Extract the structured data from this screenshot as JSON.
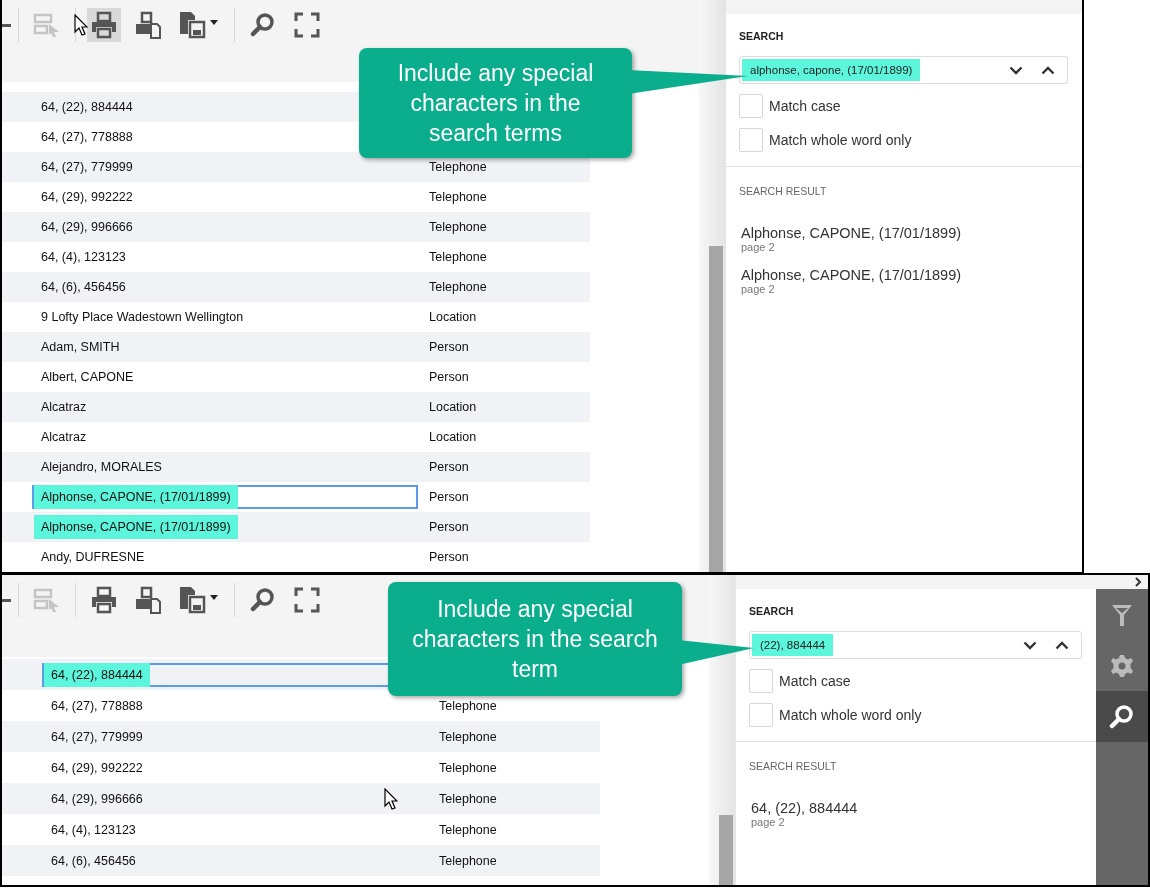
{
  "panels": [
    {
      "toolbar": [
        {
          "kind": "edge",
          "disabled": false,
          "hovered": false
        },
        {
          "kind": "select",
          "disabled": true,
          "hovered": false
        },
        {
          "kind": "print",
          "disabled": false,
          "hovered": true
        },
        {
          "kind": "export",
          "disabled": false,
          "hovered": false
        },
        {
          "kind": "save",
          "disabled": false,
          "hovered": false
        },
        {
          "kind": "search",
          "disabled": false,
          "hovered": false
        },
        {
          "kind": "fullscreen",
          "disabled": false,
          "hovered": false
        }
      ],
      "rows": [
        {
          "name": "64, (22), 884444",
          "highlighted": false,
          "selected": false
        },
        {
          "name": "64, (27), 778888",
          "highlighted": false,
          "selected": false
        },
        {
          "name": "64, (27), 779999",
          "type": "Telephone",
          "highlighted": false,
          "selected": false
        },
        {
          "name": "64, (29), 992222",
          "type": "Telephone",
          "highlighted": false,
          "selected": false
        },
        {
          "name": "64, (29), 996666",
          "type": "Telephone",
          "highlighted": false,
          "selected": false
        },
        {
          "name": "64, (4), 123123",
          "type": "Telephone",
          "highlighted": false,
          "selected": false
        },
        {
          "name": "64, (6), 456456",
          "type": "Telephone",
          "highlighted": false,
          "selected": false
        },
        {
          "name": "9 Lofty Place Wadestown Wellington",
          "type": "Location",
          "highlighted": false,
          "selected": false
        },
        {
          "name": "Adam, SMITH",
          "type": "Person",
          "highlighted": false,
          "selected": false
        },
        {
          "name": "Albert, CAPONE",
          "type": "Person",
          "highlighted": false,
          "selected": false
        },
        {
          "name": "Alcatraz",
          "type": "Location",
          "highlighted": false,
          "selected": false
        },
        {
          "name": "Alcatraz",
          "type": "Location",
          "highlighted": false,
          "selected": false
        },
        {
          "name": "Alejandro, MORALES",
          "type": "Person",
          "highlighted": false,
          "selected": false
        },
        {
          "name": "Alphonse, CAPONE, (17/01/1899)",
          "type": "Person",
          "highlighted": true,
          "selected": true
        },
        {
          "name": "Alphonse, CAPONE, (17/01/1899)",
          "type": "Person",
          "highlighted": true,
          "selected": false
        },
        {
          "name": "Andy, DUFRESNE",
          "type": "Person",
          "highlighted": false,
          "selected": false
        }
      ],
      "callout": {
        "text": "Include any special characters in the search terms"
      },
      "search": {
        "label": "SEARCH",
        "value": "alphonse, capone, (17/01/1899)",
        "options": [
          {
            "label": "Match case",
            "checked": false
          },
          {
            "label": "Match whole word only",
            "checked": false
          }
        ],
        "results_label": "SEARCH RESULT",
        "results": [
          {
            "text": "Alphonse, CAPONE, (17/01/1899)",
            "page": "page 2"
          },
          {
            "text": "Alphonse, CAPONE, (17/01/1899)",
            "page": "page 2"
          }
        ]
      }
    },
    {
      "toolbar": [
        {
          "kind": "edge",
          "disabled": false,
          "hovered": false
        },
        {
          "kind": "select",
          "disabled": true,
          "hovered": false
        },
        {
          "kind": "print",
          "disabled": false,
          "hovered": false
        },
        {
          "kind": "export",
          "disabled": false,
          "hovered": false
        },
        {
          "kind": "save",
          "disabled": false,
          "hovered": false
        },
        {
          "kind": "search",
          "disabled": false,
          "hovered": false
        },
        {
          "kind": "fullscreen",
          "disabled": false,
          "hovered": false
        }
      ],
      "rows": [
        {
          "name": "64, (22), 884444",
          "highlighted": true,
          "selected": true
        },
        {
          "name": "64, (27), 778888",
          "type": "Telephone",
          "highlighted": false,
          "selected": false
        },
        {
          "name": "64, (27), 779999",
          "type": "Telephone",
          "highlighted": false,
          "selected": false
        },
        {
          "name": "64, (29), 992222",
          "type": "Telephone",
          "highlighted": false,
          "selected": false
        },
        {
          "name": "64, (29), 996666",
          "type": "Telephone",
          "highlighted": false,
          "selected": false
        },
        {
          "name": "64, (4), 123123",
          "type": "Telephone",
          "highlighted": false,
          "selected": false
        },
        {
          "name": "64, (6), 456456",
          "type": "Telephone",
          "highlighted": false,
          "selected": false
        }
      ],
      "callout": {
        "text": "Include any special characters in the search term"
      },
      "search": {
        "label": "SEARCH",
        "value": "(22), 884444",
        "options": [
          {
            "label": "Match case",
            "checked": false
          },
          {
            "label": "Match whole word only",
            "checked": false
          }
        ],
        "results_label": "SEARCH RESULT",
        "results": [
          {
            "text": "64, (22), 884444",
            "page": "page 2"
          }
        ]
      },
      "side_tabs": [
        {
          "kind": "filter",
          "selected": false
        },
        {
          "kind": "settings",
          "selected": false
        },
        {
          "kind": "search",
          "selected": true
        }
      ]
    }
  ]
}
